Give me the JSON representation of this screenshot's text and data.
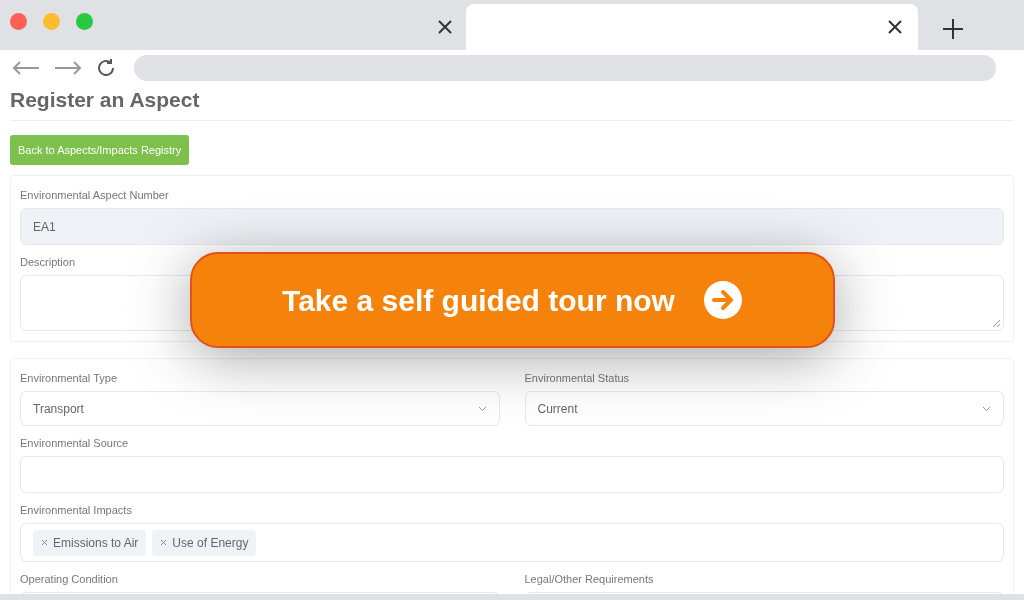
{
  "browser": {
    "tabs": [
      {
        "selected": false
      },
      {
        "selected": true
      }
    ]
  },
  "page": {
    "title": "Register an Aspect",
    "back_button": "Back to Aspects/Impacts Registry",
    "cards": [
      {
        "rows": [
          {
            "fields": [
              {
                "kind": "text",
                "label": "Environmental Aspect Number",
                "value": "EA1",
                "disabled": true
              }
            ]
          },
          {
            "fields": [
              {
                "kind": "textarea",
                "label": "Description"
              }
            ]
          }
        ]
      },
      {
        "rows": [
          {
            "fields": [
              {
                "kind": "select",
                "label": "Environmental Type",
                "value": "Transport"
              },
              {
                "kind": "select",
                "label": "Environmental Status",
                "value": "Current"
              }
            ]
          },
          {
            "fields": [
              {
                "kind": "text",
                "label": "Environmental Source"
              }
            ]
          },
          {
            "fields": [
              {
                "kind": "tags",
                "label": "Environmental Impacts",
                "tags": [
                  "Emissions to Air",
                  "Use of Energy"
                ]
              }
            ]
          },
          {
            "fields": [
              {
                "kind": "text",
                "label": "Operating Condition"
              },
              {
                "kind": "text",
                "label": "Legal/Other Requirements"
              }
            ]
          }
        ]
      }
    ]
  },
  "cta": {
    "label": "Take a self guided tour now"
  }
}
